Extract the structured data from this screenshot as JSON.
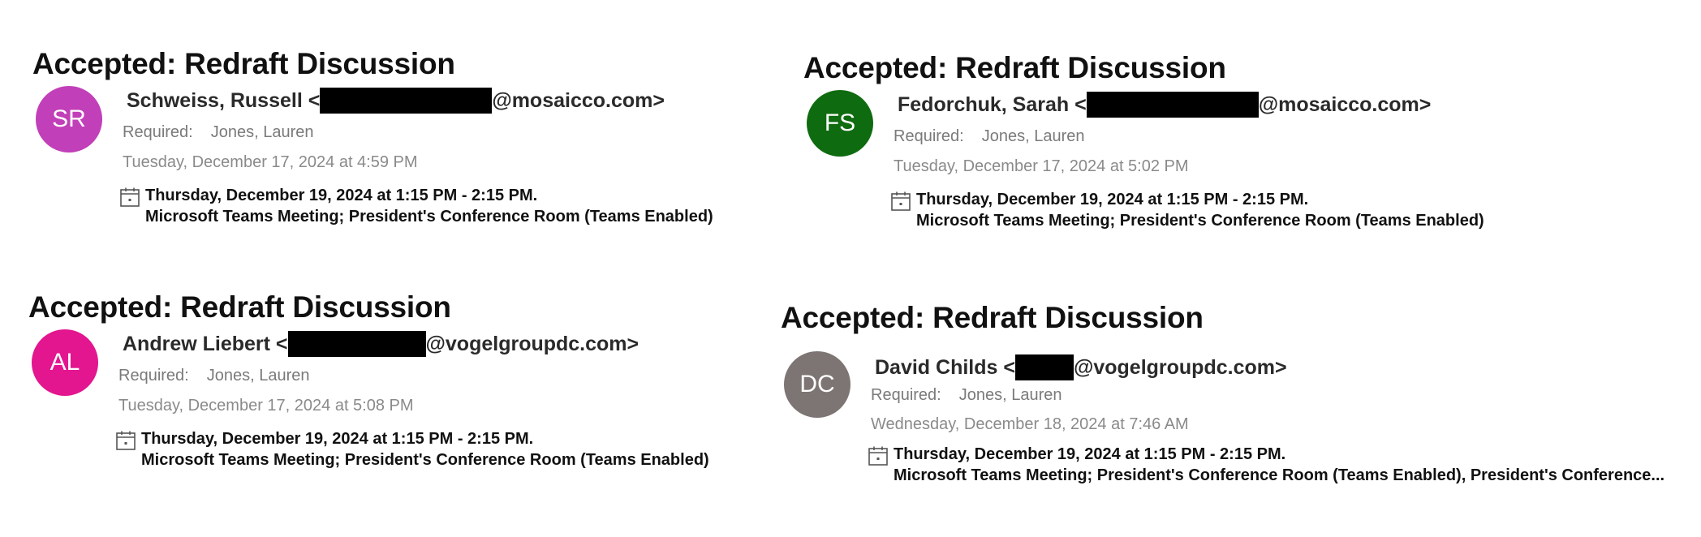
{
  "cards": [
    {
      "title": "Accepted: Redraft Discussion",
      "avatar": {
        "initials": "SR",
        "color": "#c13fb8"
      },
      "sender_name": "Schweiss, Russell <",
      "sender_domain": "@mosaicco.com>",
      "required_label": "Required:",
      "required_value": "Jones, Lauren",
      "sent_time": "Tuesday, December 17, 2024 at 4:59 PM",
      "meeting_time": "Thursday, December 19, 2024 at 1:15 PM - 2:15 PM.",
      "meeting_location": "Microsoft Teams Meeting; President's Conference Room (Teams Enabled)"
    },
    {
      "title": "Accepted: Redraft Discussion",
      "avatar": {
        "initials": "FS",
        "color": "#0f6b0f"
      },
      "sender_name": "Fedorchuk, Sarah <",
      "sender_domain": "@mosaicco.com>",
      "required_label": "Required:",
      "required_value": "Jones, Lauren",
      "sent_time": "Tuesday, December 17, 2024 at 5:02 PM",
      "meeting_time": "Thursday, December 19, 2024 at 1:15 PM - 2:15 PM.",
      "meeting_location": "Microsoft Teams Meeting; President's Conference Room (Teams Enabled)"
    },
    {
      "title": "Accepted: Redraft Discussion",
      "avatar": {
        "initials": "AL",
        "color": "#e3158f"
      },
      "sender_name": "Andrew Liebert <",
      "sender_domain": "@vogelgroupdc.com>",
      "required_label": "Required:",
      "required_value": "Jones, Lauren",
      "sent_time": "Tuesday, December 17, 2024 at 5:08 PM",
      "meeting_time": "Thursday, December 19, 2024 at 1:15 PM - 2:15 PM.",
      "meeting_location": "Microsoft Teams Meeting; President's Conference Room (Teams Enabled)"
    },
    {
      "title": "Accepted: Redraft Discussion",
      "avatar": {
        "initials": "DC",
        "color": "#7d7573"
      },
      "sender_name": "David Childs <",
      "sender_domain": "@vogelgroupdc.com>",
      "required_label": "Required:",
      "required_value": "Jones, Lauren",
      "sent_time": "Wednesday, December 18, 2024 at 7:46 AM",
      "meeting_time": "Thursday, December 19, 2024 at 1:15 PM - 2:15 PM.",
      "meeting_location": "Microsoft Teams Meeting; President's Conference Room (Teams Enabled), President's Conference..."
    }
  ]
}
